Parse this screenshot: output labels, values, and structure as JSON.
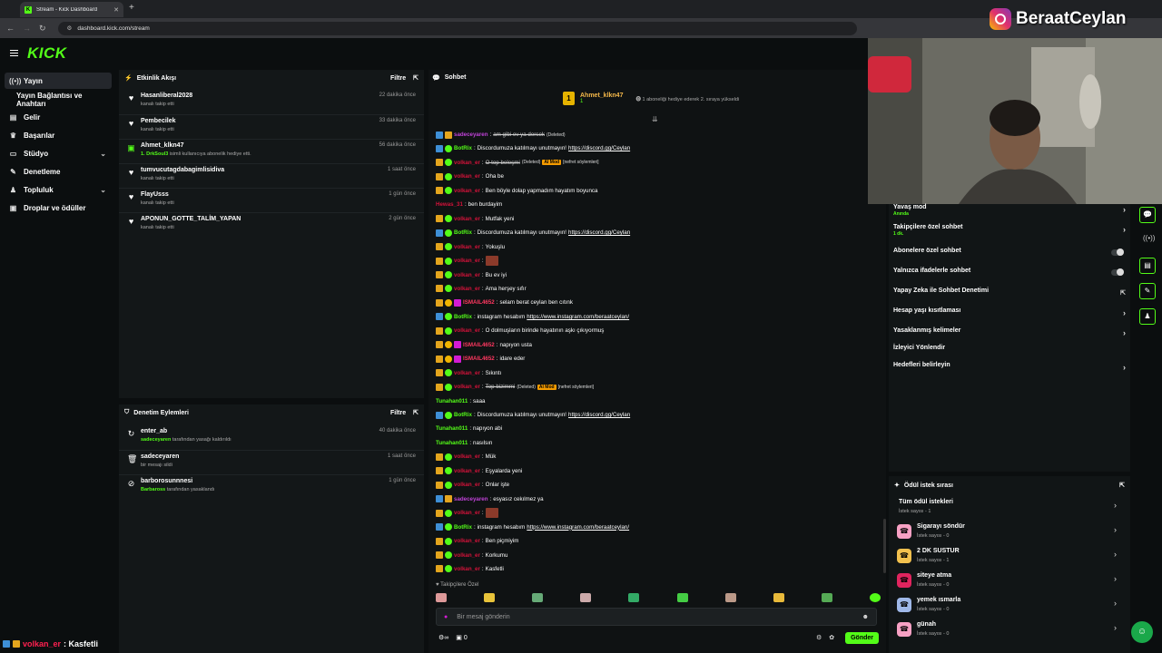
{
  "browser": {
    "tab_title": "Stream - Kick Dashboard",
    "url": "dashboard.kick.com/stream"
  },
  "brand": {
    "logo": "KICK",
    "accent": "#53fc18"
  },
  "watermark": {
    "text": "BeraatCeylan"
  },
  "sidebar": {
    "items": [
      {
        "label": "Yayın",
        "icon": "radio-icon"
      },
      {
        "label": "Yayın Bağlantısı ve Anahtarı",
        "icon": ""
      },
      {
        "label": "Gelir",
        "icon": "money-icon"
      },
      {
        "label": "Başarılar",
        "icon": "trophy-icon"
      },
      {
        "label": "Stüdyo",
        "icon": "monitor-icon"
      },
      {
        "label": "Denetleme",
        "icon": "wrench-icon"
      },
      {
        "label": "Topluluk",
        "icon": "people-icon"
      },
      {
        "label": "Droplar ve ödüller",
        "icon": "gift-icon"
      }
    ],
    "current_user": "volkan_er",
    "current_msg": ": Kasfetli"
  },
  "activity": {
    "title": "Etkinlik Akışı",
    "filter": "Filtre",
    "rows": [
      {
        "name": "Hasanliberal2028",
        "sub": "kanalı takip etti",
        "time": "22 dakika önce"
      },
      {
        "name": "Pembecilek",
        "sub": "kanalı takip etti",
        "time": "33 dakika önce"
      },
      {
        "name": "Ahmet_klkn47",
        "sub_bold": "1. DrkSoul3",
        "sub": " isimli kullanıcıya abonelik hediye etti.",
        "time": "56 dakika önce"
      },
      {
        "name": "tumvucutagdabagimlisidiva",
        "sub": "kanalı takip etti",
        "time": "1 saat önce"
      },
      {
        "name": "FlayUsss",
        "sub": "kanalı takip etti",
        "time": "1 gün önce"
      },
      {
        "name": "APONUN_GOTTE_TALİM_YAPAN",
        "sub": "kanalı takip etti",
        "time": "2 gün önce"
      }
    ]
  },
  "moderation": {
    "title": "Denetim Eylemleri",
    "filter": "Filtre",
    "rows": [
      {
        "name": "enter_ab",
        "sub_bold": "sadeceyaren",
        "sub": " tarafından yasağı kaldırıldı",
        "time": "40 dakika önce"
      },
      {
        "name": "sadeceyaren",
        "sub": "bir mesajı sildi",
        "time": "1 saat önce"
      },
      {
        "name": "barborosunnnesi",
        "sub_bold": "Barbaross",
        "sub": " tarafından yasaklandı",
        "time": "1 gün önce"
      }
    ]
  },
  "chat": {
    "title": "Sohbet",
    "pinned": {
      "name": "Ahmet_klkn47",
      "count": "1",
      "text": "1 aboneliği hediye ederek 2. sıraya yükseldi",
      "rank": "1"
    },
    "messages": [
      {
        "user": "sadeceyaren",
        "text": "am gibi ev ya dersek",
        "suffix": "(Deleted)",
        "color": "mag",
        "badges": [
          "mod",
          "sub"
        ],
        "deleted": true
      },
      {
        "user": "BotRix",
        "text": "Discordumuza katılmayı unutmayın!",
        "link": "https://discord.gg/Ceylan",
        "color": "green",
        "badges": [
          "mod",
          "ver"
        ]
      },
      {
        "user": "volkan_er",
        "text": "O top beleşmi",
        "suffix": "(Deleted)",
        "tag": "AI Mod",
        "tag2": "[nefret söylemleri]",
        "color": "red",
        "badges": [
          "sub",
          "ver"
        ],
        "deleted": true
      },
      {
        "user": "volkan_er",
        "text": "Oha be",
        "color": "red",
        "badges": [
          "sub",
          "ver"
        ]
      },
      {
        "user": "volkan_er",
        "text": "Ben böyle dolap yapmadım hayatım boyunca",
        "color": "red",
        "badges": [
          "sub",
          "ver"
        ]
      },
      {
        "user": "Hewas_31",
        "text": "ben burdayim",
        "color": "red",
        "badges": []
      },
      {
        "user": "volkan_er",
        "text": "Mutfak yeni",
        "color": "red",
        "badges": [
          "sub",
          "ver"
        ]
      },
      {
        "user": "BotRix",
        "text": "Discordumuza katılmayı unutmayın!",
        "link": "https://discord.gg/Ceylan",
        "color": "green",
        "badges": [
          "mod",
          "ver"
        ]
      },
      {
        "user": "volkan_er",
        "text": "Yokuşlu",
        "color": "red",
        "badges": [
          "sub",
          "ver"
        ]
      },
      {
        "user": "volkan_er",
        "text": "",
        "emote": true,
        "color": "red",
        "badges": [
          "sub",
          "ver"
        ]
      },
      {
        "user": "volkan_er",
        "text": "Bu ev iyi",
        "color": "red",
        "badges": [
          "sub",
          "ver"
        ]
      },
      {
        "user": "volkan_er",
        "text": "Ama herşey sıfır",
        "color": "red",
        "badges": [
          "sub",
          "ver"
        ]
      },
      {
        "user": "ISMAIL4652",
        "text": "selam berat ceylan ben cıtınk",
        "color": "pink",
        "badges": [
          "sub",
          "gold",
          "vip"
        ]
      },
      {
        "user": "BotRix",
        "text": "instagram hesabım",
        "link": "https://www.instagram.com/beraatceylan/",
        "color": "green",
        "badges": [
          "mod",
          "ver"
        ]
      },
      {
        "user": "volkan_er",
        "text": "O dolmuşların birinde hayatının aşkı çıkıyormuş",
        "color": "red",
        "badges": [
          "sub",
          "ver"
        ]
      },
      {
        "user": "ISMAIL4652",
        "text": "napıyon usta",
        "color": "pink",
        "badges": [
          "sub",
          "gold",
          "vip"
        ]
      },
      {
        "user": "ISMAIL4652",
        "text": "idare eder",
        "color": "pink",
        "badges": [
          "sub",
          "gold",
          "vip"
        ]
      },
      {
        "user": "volkan_er",
        "text": "Sıkıntı",
        "color": "red",
        "badges": [
          "sub",
          "ver"
        ]
      },
      {
        "user": "volkan_er",
        "text": "Top bizimmi",
        "suffix": "(Deleted)",
        "tag": "AI Mod",
        "tag2": "[nefret söylemleri]",
        "color": "red",
        "badges": [
          "sub",
          "ver"
        ],
        "deleted": true
      },
      {
        "user": "Tunahan011",
        "text": "saaa",
        "color": "green",
        "badges": []
      },
      {
        "user": "BotRix",
        "text": "Discordumuza katılmayı unutmayın!",
        "link": "https://discord.gg/Ceylan",
        "color": "green",
        "badges": [
          "mod",
          "ver"
        ]
      },
      {
        "user": "Tunahan011",
        "text": "napıyon abi",
        "color": "green",
        "badges": []
      },
      {
        "user": "Tunahan011",
        "text": "nasılsın",
        "color": "green",
        "badges": []
      },
      {
        "user": "volkan_er",
        "text": "Mük",
        "color": "red",
        "badges": [
          "sub",
          "ver"
        ]
      },
      {
        "user": "volkan_er",
        "text": "Eşyalarda yeni",
        "color": "red",
        "badges": [
          "sub",
          "ver"
        ]
      },
      {
        "user": "volkan_er",
        "text": "Onlar işte",
        "color": "red",
        "badges": [
          "sub",
          "ver"
        ]
      },
      {
        "user": "sadeceyaren",
        "text": "esyasız cekılmez ya",
        "color": "mag",
        "badges": [
          "mod",
          "sub"
        ]
      },
      {
        "user": "volkan_er",
        "text": "",
        "emote": true,
        "color": "red",
        "badges": [
          "sub",
          "ver"
        ]
      },
      {
        "user": "BotRix",
        "text": "instagram hesabım",
        "link": "https://www.instagram.com/beraatceylan/",
        "color": "green",
        "badges": [
          "mod",
          "ver"
        ]
      },
      {
        "user": "volkan_er",
        "text": "Ben piçmiyim",
        "color": "red",
        "badges": [
          "sub",
          "ver"
        ]
      },
      {
        "user": "volkan_er",
        "text": "Korkumu",
        "color": "red",
        "badges": [
          "sub",
          "ver"
        ]
      },
      {
        "user": "volkan_er",
        "text": "Kasfetli",
        "color": "red",
        "badges": [
          "sub",
          "ver"
        ]
      }
    ],
    "followers_label": "Takipçilere Özel",
    "input_placeholder": "Bir mesaj gönderin",
    "infinity": "∞",
    "count": "0",
    "send": "Gönder"
  },
  "settings": {
    "rows": [
      {
        "label": "Yavaş mod",
        "sub": "Anında",
        "control": "arrow"
      },
      {
        "label": "Takipçilere özel sohbet",
        "sub": "1 dk.",
        "control": "arrow"
      },
      {
        "label": "Abonelere özel sohbet",
        "control": "toggle"
      },
      {
        "label": "Yalnızca ifadelerle sohbet",
        "control": "toggle"
      },
      {
        "label": "Yapay Zeka ile Sohbet Denetimi",
        "control": "external"
      },
      {
        "label": "Hesap yaşı kısıtlaması",
        "control": "arrow"
      },
      {
        "label": "Yasaklanmış kelimeler",
        "control": "arrow"
      },
      {
        "label": "İzleyici Yönlendir",
        "control": "none"
      },
      {
        "label": "Hedefleri belirleyin",
        "control": "arrow"
      }
    ]
  },
  "rewards": {
    "title": "Ödül istek sırası",
    "items": [
      {
        "title": "Tüm ödül istekleri",
        "sub": "İstek sayısı - 1",
        "color": ""
      },
      {
        "title": "Sigarayı söndür",
        "sub": "İstek sayısı - 0",
        "color": "#f7a1c4"
      },
      {
        "title": "2 DK SUSTUR",
        "sub": "İstek sayısı - 1",
        "color": "#f2c14e"
      },
      {
        "title": "siteye atma",
        "sub": "İstek sayısı - 0",
        "color": "#e0245e"
      },
      {
        "title": "yemek ısmarla",
        "sub": "İstek sayısı - 0",
        "color": "#9fb8e8"
      },
      {
        "title": "günah",
        "sub": "İstek sayısı - 0",
        "color": "#f7a1c4"
      }
    ]
  }
}
